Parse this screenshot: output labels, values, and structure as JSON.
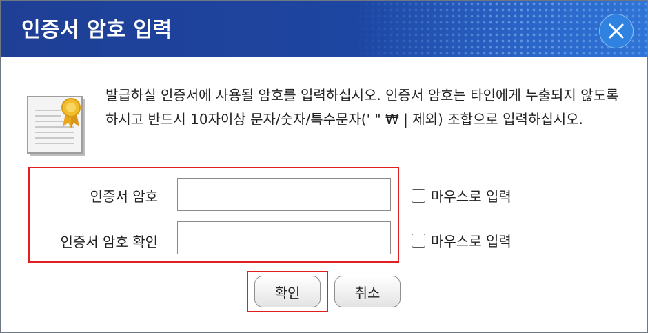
{
  "window": {
    "title": "인증서 암호 입력",
    "close_icon": "close-icon"
  },
  "message": "발급하실 인증서에 사용될 암호를 입력하십시오. 인증서 암호는 타인에게 누출되지 않도록 하시고 반드시 10자이상 문자/숫자/특수문자(' \" ₩ | 제외) 조합으로 입력하십시오.",
  "icon": "certificate-icon",
  "form": {
    "password": {
      "label": "인증서 암호",
      "value": "",
      "mouse_input_label": "마우스로 입력",
      "mouse_input_checked": false
    },
    "confirm": {
      "label": "인증서 암호 확인",
      "value": "",
      "mouse_input_label": "마우스로 입력",
      "mouse_input_checked": false
    }
  },
  "buttons": {
    "ok_label": "확인",
    "cancel_label": "취소"
  },
  "colors": {
    "titlebar": "#1f3f95",
    "highlight": "#e02020",
    "close_button": "#2f82e0"
  }
}
